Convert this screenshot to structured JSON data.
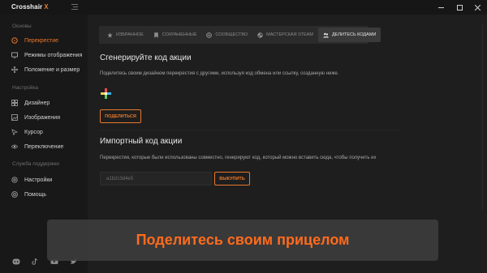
{
  "app": {
    "name": "Crosshair",
    "name_accent": "X"
  },
  "window": {
    "minimize_icon": "minimize-icon",
    "maximize_icon": "maximize-icon",
    "close_icon": "close-icon"
  },
  "sidebar": {
    "sections": [
      {
        "title": "Основы",
        "items": [
          {
            "label": "Перекрестие",
            "icon": "crosshair-icon",
            "active": true
          },
          {
            "label": "Режимы отображения",
            "icon": "display-icon",
            "active": false
          },
          {
            "label": "Положение и размер",
            "icon": "move-icon",
            "active": false
          }
        ]
      },
      {
        "title": "Настройка",
        "items": [
          {
            "label": "Дизайнер",
            "icon": "designer-icon",
            "active": false
          },
          {
            "label": "Изображения",
            "icon": "image-icon",
            "active": false
          },
          {
            "label": "Курсор",
            "icon": "cursor-icon",
            "active": false
          },
          {
            "label": "Переключение",
            "icon": "eye-icon",
            "active": false
          }
        ]
      },
      {
        "title": "Служба поддержки",
        "items": [
          {
            "label": "Настройки",
            "icon": "settings-icon",
            "active": false
          },
          {
            "label": "Помощь",
            "icon": "help-icon",
            "active": false
          }
        ]
      }
    ],
    "social": [
      "discord-icon",
      "tiktok-icon",
      "youtube-icon",
      "twitter-icon"
    ]
  },
  "tabs": [
    {
      "label": "Избранное",
      "icon": "star-icon",
      "active": false
    },
    {
      "label": "Сохраненные",
      "icon": "bookmark-icon",
      "active": false
    },
    {
      "label": "Сообщество",
      "icon": "globe-icon",
      "active": false
    },
    {
      "label": "Мастерская Steam",
      "icon": "steam-icon",
      "active": false
    },
    {
      "label": "Делитесь кодами",
      "icon": "users-icon",
      "active": true
    }
  ],
  "generate": {
    "title": "Сгенерируйте код акции",
    "description": "Поделитесь своим дизайном перекрестия с другими, используя код обмена или ссылку, созданную ниже.",
    "share_button": "Поделиться"
  },
  "import": {
    "title": "Импортный код акции",
    "description": "Перекрестия, которые были использованы совместно, генерируют код, который можно вставить сюда, чтобы получить их",
    "input_placeholder": "a1b2c3d4e5",
    "submit_button": "Выкупить"
  },
  "caption": {
    "text": "Поделитесь своим прицелом"
  },
  "colors": {
    "accent": "#e8782c",
    "caption_text": "#ff6b1c",
    "background": "#1e1e1e",
    "sidebar": "#181818"
  }
}
